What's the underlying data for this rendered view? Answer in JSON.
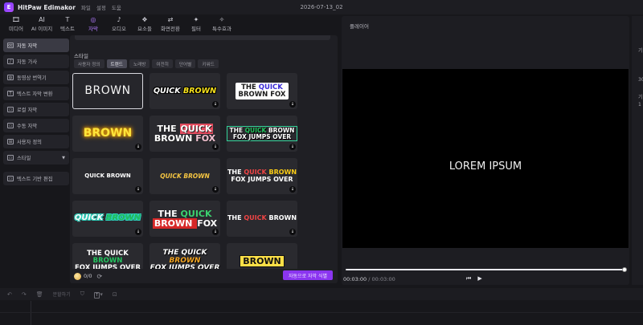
{
  "app": {
    "name": "HitPaw Edimakor",
    "logo_letter": "E",
    "menu": [
      "파일",
      "설정",
      "도움"
    ],
    "project_title": "2026-07-13_02"
  },
  "toolbar": [
    {
      "label": "미디어",
      "icon": "🎞"
    },
    {
      "label": "AI 이미지",
      "icon": "AI"
    },
    {
      "label": "텍스트",
      "icon": "T"
    },
    {
      "label": "자막",
      "icon": "◎",
      "active": true
    },
    {
      "label": "오디오",
      "icon": "♪"
    },
    {
      "label": "요소들",
      "icon": "❖"
    },
    {
      "label": "화면전환",
      "icon": "⇄"
    },
    {
      "label": "필터",
      "icon": "✦"
    },
    {
      "label": "특수효과",
      "icon": "✧"
    }
  ],
  "sidebar": {
    "items": [
      {
        "label": "자동 자막",
        "icon": "cc",
        "active": true
      },
      {
        "label": "자동 가사",
        "icon": "♪"
      },
      {
        "label": "동영상 번역기",
        "icon": "◍"
      },
      {
        "label": "텍스트 자막 변환",
        "icon": "T"
      },
      {
        "label": "로컬 자막",
        "icon": "▭"
      },
      {
        "label": "수동 자막",
        "icon": "▭"
      },
      {
        "label": "사용자 정의",
        "icon": "⊞"
      },
      {
        "label": "스타일",
        "icon": "▭",
        "caret": true
      },
      {
        "label": "텍스트 기반 편집",
        "icon": "▭",
        "gap": true
      }
    ]
  },
  "styles": {
    "section_label": "스타일",
    "tabs": [
      {
        "label": "사용자 정의"
      },
      {
        "label": "트렌드",
        "active": true
      },
      {
        "label": "노래방"
      },
      {
        "label": "여전히"
      },
      {
        "label": "단어별"
      },
      {
        "label": "키워드"
      }
    ],
    "download_icon": "↓",
    "presets": {
      "p1": "BROWN",
      "p2": [
        "QUICK ",
        "BROWN"
      ],
      "p3": [
        "THE ",
        "QUICK",
        " BROWN FOX"
      ],
      "p4": "BROWN",
      "p5": [
        "THE ",
        "QUICK",
        " BROWN ",
        "FOX"
      ],
      "p6": [
        "THE ",
        "QUICK",
        " BROWN FOX JUMPS OVER"
      ],
      "p7": "QUICK BROWN",
      "p8": "QUICK BROWN",
      "p9": [
        "THE ",
        "QUICK",
        " ",
        "BROWN",
        " FOX JUMPS OVER"
      ],
      "p10": [
        "QUICK ",
        "BROWN"
      ],
      "p11": [
        "THE ",
        "QUICK",
        " BROWN ",
        "FOX"
      ],
      "p12": [
        "THE ",
        "QUICK",
        " BROWN"
      ],
      "p13": [
        "THE QUICK ",
        "BROWN",
        " FOX JUMPS OVER"
      ],
      "p14": [
        "THE QUICK ",
        "BROWN",
        " FOX JUMPS OVER"
      ],
      "p15": "BROWN"
    }
  },
  "footer": {
    "credits": "0/0",
    "refresh_icon": "⟳",
    "apply_label": "자동으로 자막 식별"
  },
  "player": {
    "label": "플레이어",
    "caption": "LOREM IPSUM",
    "current_time": "00:03:00",
    "separator": " / ",
    "total_time": "00:03:00",
    "progress": 1.0,
    "prev_icon": "⏮",
    "play_icon": "▶"
  },
  "properties_values": [
    "기",
    "30",
    "기",
    "1"
  ],
  "timeline": {
    "undo_icon": "↶",
    "redo_icon": "↷",
    "delete_icon": "🗑",
    "split_label": "분할하기",
    "shield_icon": "⛉",
    "text_chip": "T",
    "caret": "▾",
    "frame_icon": "⊡"
  },
  "colors": {
    "accent": "#8b35f0",
    "active_tab_text": "#b27bff"
  }
}
